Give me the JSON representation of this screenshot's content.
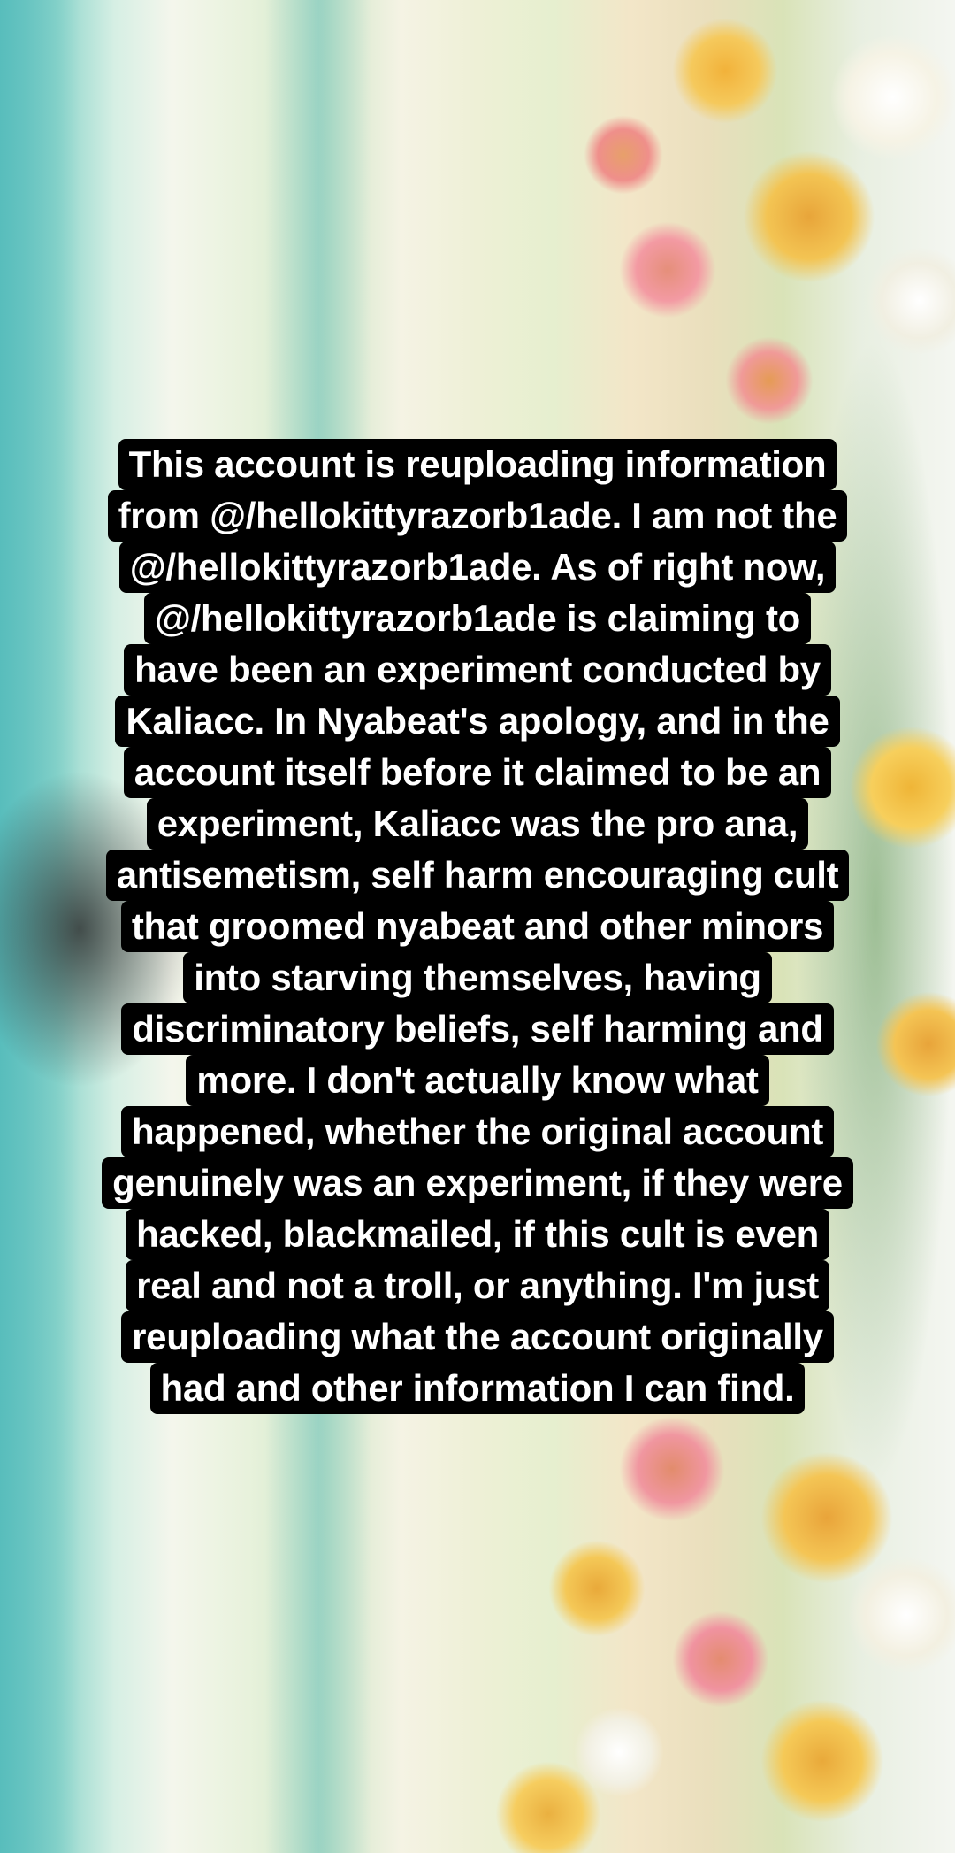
{
  "story": {
    "lines": [
      "This account is reuploading information",
      "from @/hellokittyrazorb1ade. I am not the",
      "@/hellokittyrazorb1ade. As of right now,",
      "@/hellokittyrazorb1ade is claiming to",
      "have been an experiment conducted by",
      "Kaliacc. In Nyabeat's apology, and in the",
      "account itself before it claimed to be an",
      "experiment, Kaliacc was the pro ana,",
      "antisemetism, self harm encouraging cult",
      "that groomed nyabeat and other minors",
      "into starving themselves, having",
      "discriminatory beliefs, self harming and",
      "more. I don't actually know what",
      "happened, whether the original account",
      "genuinely was an experiment, if they were",
      "hacked, blackmailed, if this cult is even",
      "real and not a troll, or anything. I'm just",
      "reuploading what the account originally",
      "had and other information I can find."
    ],
    "text_color": "#ffffff",
    "highlight_color": "#000000"
  }
}
